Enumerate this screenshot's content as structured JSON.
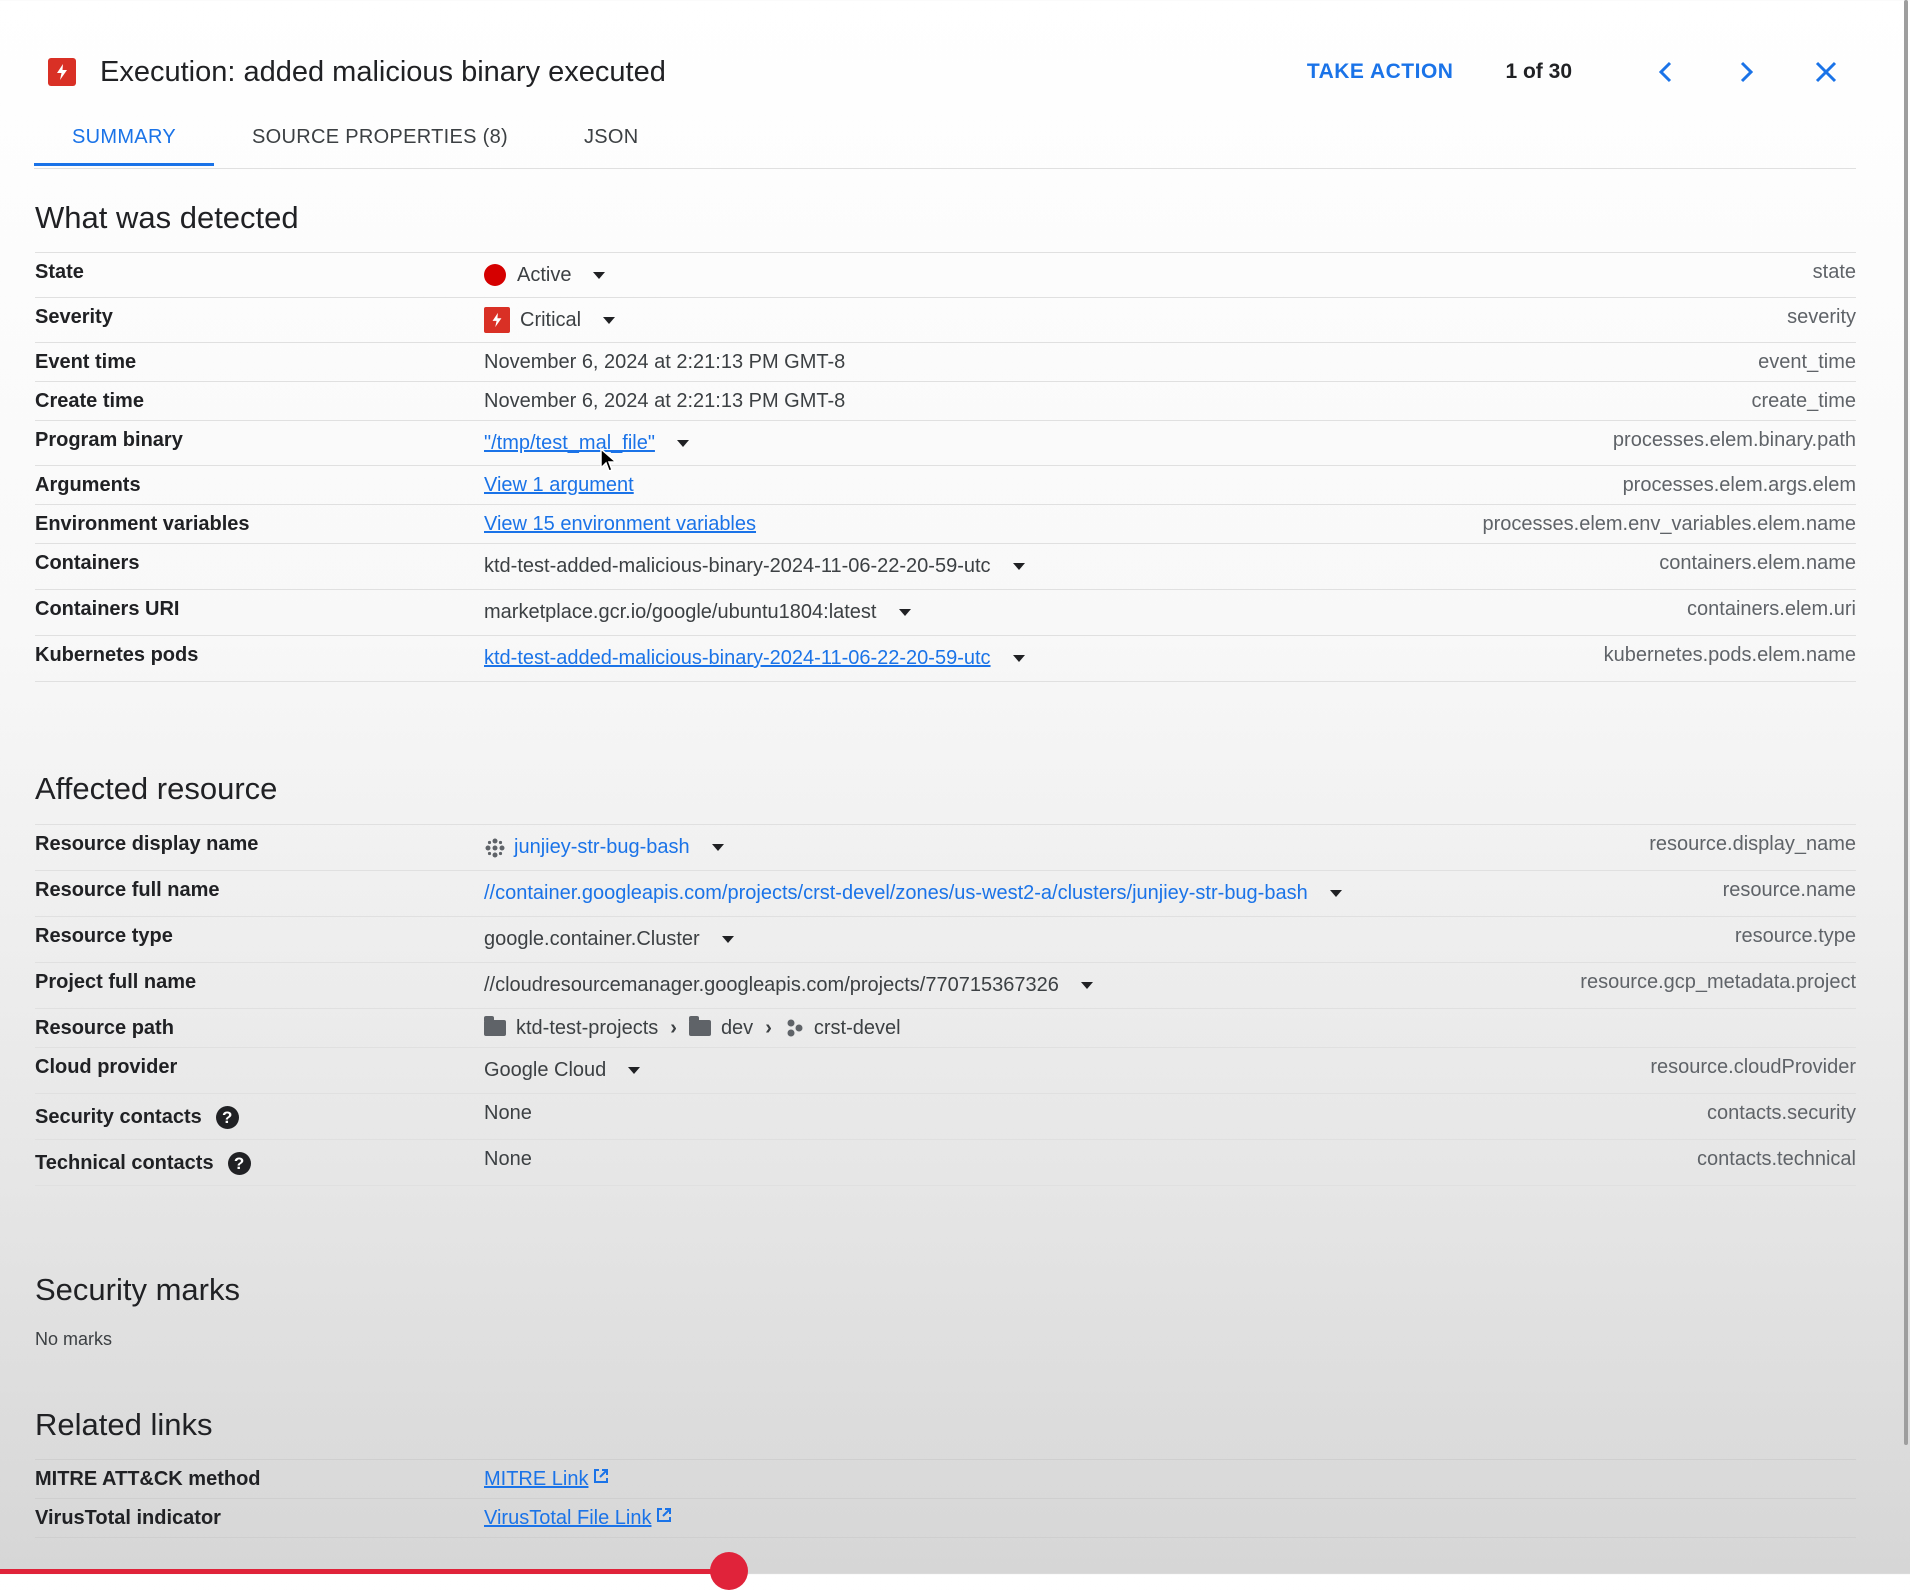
{
  "header": {
    "title": "Execution: added malicious binary executed",
    "take_action": "TAKE ACTION",
    "count": "1 of 30",
    "severity_color": "#d93025"
  },
  "tabs": [
    {
      "label": "SUMMARY",
      "active": true
    },
    {
      "label": "SOURCE PROPERTIES (8)",
      "active": false
    },
    {
      "label": "JSON",
      "active": false
    }
  ],
  "detected": {
    "title": "What was detected",
    "rows": [
      {
        "label": "State",
        "value": "Active",
        "field": "state"
      },
      {
        "label": "Severity",
        "value": "Critical",
        "field": "severity"
      },
      {
        "label": "Event time",
        "value": "November 6, 2024 at 2:21:13 PM GMT-8",
        "field": "event_time"
      },
      {
        "label": "Create time",
        "value": "November 6, 2024 at 2:21:13 PM GMT-8",
        "field": "create_time"
      },
      {
        "label": "Program binary",
        "value": "\"/tmp/test_mal_file\"",
        "field": "processes.elem.binary.path"
      },
      {
        "label": "Arguments",
        "value": "View 1 argument",
        "field": "processes.elem.args.elem"
      },
      {
        "label": "Environment variables",
        "value": "View 15 environment variables",
        "field": "processes.elem.env_variables.elem.name"
      },
      {
        "label": "Containers",
        "value": "ktd-test-added-malicious-binary-2024-11-06-22-20-59-utc",
        "field": "containers.elem.name"
      },
      {
        "label": "Containers URI",
        "value": "marketplace.gcr.io/google/ubuntu1804:latest",
        "field": "containers.elem.uri"
      },
      {
        "label": "Kubernetes pods",
        "value": "ktd-test-added-malicious-binary-2024-11-06-22-20-59-utc",
        "field": "kubernetes.pods.elem.name"
      }
    ]
  },
  "affected": {
    "title": "Affected resource",
    "rows": [
      {
        "label": "Resource display name",
        "value": "junjiey-str-bug-bash",
        "field": "resource.display_name"
      },
      {
        "label": "Resource full name",
        "value": "//container.googleapis.com/projects/crst-devel/zones/us-west2-a/clusters/junjiey-str-bug-bash",
        "field": "resource.name"
      },
      {
        "label": "Resource type",
        "value": "google.container.Cluster",
        "field": "resource.type"
      },
      {
        "label": "Project full name",
        "value": "//cloudresourcemanager.googleapis.com/projects/770715367326",
        "field": "resource.gcp_metadata.project"
      },
      {
        "label": "Resource path",
        "path": [
          "ktd-test-projects",
          "dev",
          "crst-devel"
        ],
        "field": ""
      },
      {
        "label": "Cloud provider",
        "value": "Google Cloud",
        "field": "resource.cloudProvider"
      },
      {
        "label": "Security contacts",
        "value": "None",
        "field": "contacts.security"
      },
      {
        "label": "Technical contacts",
        "value": "None",
        "field": "contacts.technical"
      }
    ]
  },
  "marks": {
    "title": "Security marks",
    "text": "No marks"
  },
  "related": {
    "title": "Related links",
    "rows": [
      {
        "label": "MITRE ATT&CK method",
        "value": "MITRE Link"
      },
      {
        "label": "VirusTotal indicator",
        "value": "VirusTotal File Link"
      }
    ]
  },
  "colors": {
    "accent": "#1a73e8",
    "active_dot": "#d50000",
    "critical": "#d93025",
    "player_progress": "#e0233a"
  }
}
